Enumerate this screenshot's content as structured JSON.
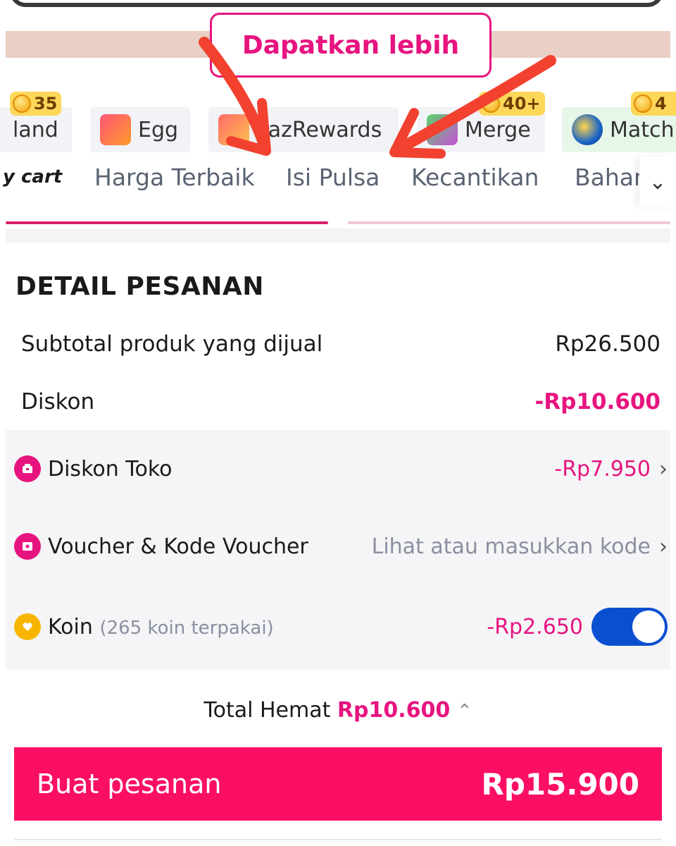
{
  "banner": {
    "pill_text": "Dapatkan lebih"
  },
  "games": [
    {
      "label": "land",
      "badge": "35"
    },
    {
      "label": "Egg",
      "badge": ""
    },
    {
      "label": "LazRewards",
      "badge": ""
    },
    {
      "label": "Merge",
      "badge": "40+"
    },
    {
      "label": "Match",
      "badge": "4"
    }
  ],
  "categories": {
    "active": "y cart",
    "items": [
      "Harga Terbaik",
      "Isi Pulsa",
      "Kecantikan",
      "Bahan"
    ],
    "more_icon": "chevron-down-icon"
  },
  "order": {
    "title": "DETAIL PESANAN",
    "subtotal_label": "Subtotal produk yang dijual",
    "subtotal_value": "Rp26.500",
    "discount_label": "Diskon",
    "discount_value": "-Rp10.600",
    "store_discount_label": "Diskon Toko",
    "store_discount_value": "-Rp7.950",
    "voucher_label": "Voucher & Kode Voucher",
    "voucher_value": "Lihat atau masukkan kode",
    "coin_label": "Koin",
    "coin_note": "(265 koin terpakai)",
    "coin_value": "-Rp2.650",
    "coin_toggle_on": true
  },
  "summary": {
    "total_savings_label": "Total Hemat",
    "total_savings_value": "Rp10.600"
  },
  "cta": {
    "label": "Buat pesanan",
    "amount": "Rp15.900"
  },
  "colors": {
    "accent_pink": "#e7147f",
    "cta_pink": "#fb0f65",
    "toggle_blue": "#0b4fd1"
  }
}
